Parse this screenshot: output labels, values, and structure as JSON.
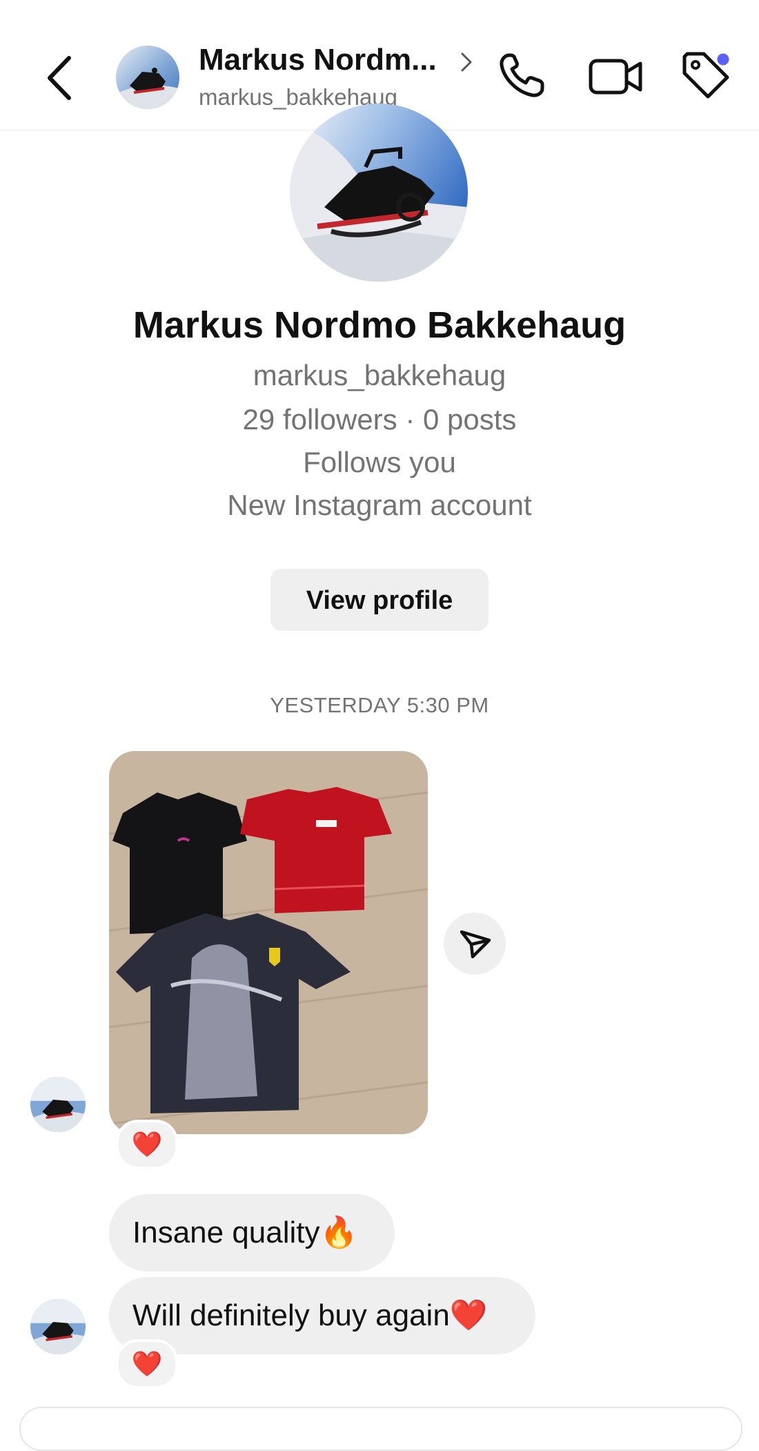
{
  "header": {
    "name": "Markus Nordm...",
    "username": "markus_bakkehaug"
  },
  "profile": {
    "full_name": "Markus Nordmo Bakkehaug",
    "username": "markus_bakkehaug",
    "stats": "29 followers · 0 posts",
    "follows_you": "Follows you",
    "account_note": "New Instagram account",
    "view_profile_label": "View profile"
  },
  "thread": {
    "timestamp": "YESTERDAY 5:30 PM",
    "messages": [
      {
        "type": "photo",
        "reaction": "❤️"
      },
      {
        "type": "text",
        "text": "Insane quality🔥"
      },
      {
        "type": "text",
        "text": "Will definitely buy again❤️",
        "reaction": "❤️"
      }
    ]
  },
  "icons": {
    "back": "chevron-left-icon",
    "phone": "phone-icon",
    "video": "video-camera-icon",
    "tag": "tag-icon",
    "share": "paper-plane-icon"
  },
  "colors": {
    "notification_dot": "#5b5ff5",
    "bubble": "#efefef",
    "secondary_text": "#737373"
  }
}
